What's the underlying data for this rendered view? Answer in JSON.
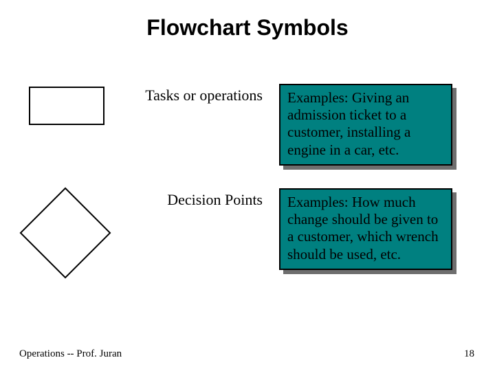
{
  "title": "Flowchart Symbols",
  "rows": [
    {
      "symbol": "rectangle",
      "label": "Tasks or operations",
      "example": "Examples: Giving an admission ticket to a customer, installing a engine in a car, etc."
    },
    {
      "symbol": "diamond",
      "label": "Decision Points",
      "example": "Examples: How much change should be given to a customer, which wrench should be used, etc."
    }
  ],
  "footer": "Operations  --  Prof. Juran",
  "page_number": "18"
}
